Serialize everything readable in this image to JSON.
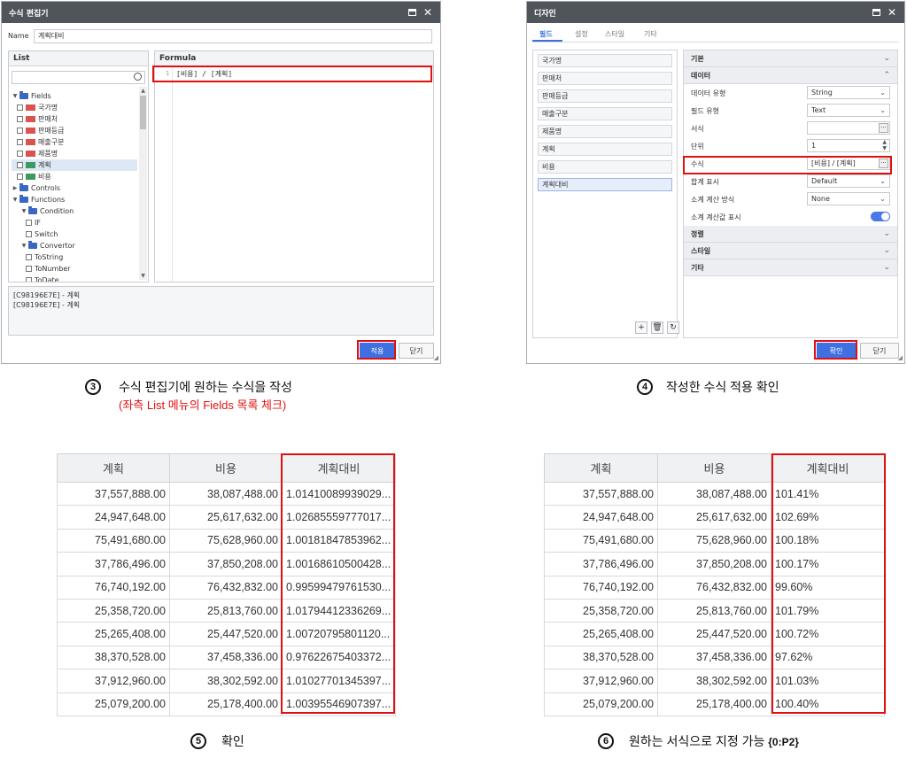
{
  "formula_editor": {
    "title": "수식 편집기",
    "name_label": "Name",
    "name_value": "계획대비",
    "list_header": "List",
    "formula_header": "Formula",
    "formula_line_no": "1",
    "formula_text": "[비용] / [계획]",
    "tree": {
      "fields": "Fields",
      "field_items": [
        "국가명",
        "판매처",
        "판매등급",
        "매출구분",
        "제품명",
        "계획",
        "비용"
      ],
      "controls": "Controls",
      "functions": "Functions",
      "condition": "Condition",
      "condition_items": [
        "IF",
        "Switch"
      ],
      "convertor": "Convertor",
      "convertor_items": [
        "ToString",
        "ToNumber",
        "ToDate"
      ]
    },
    "info_lines": [
      "[C98196E7E] - 계획",
      "[C98196E7E] - 계획"
    ],
    "apply_label": "적용",
    "close_label": "닫기"
  },
  "design_dialog": {
    "title": "디자인",
    "tabs": [
      "필드",
      "설정",
      "스타일",
      "기타"
    ],
    "field_list": [
      "국가명",
      "판매처",
      "판매등급",
      "매출구분",
      "제품명",
      "계획",
      "비용",
      "계획대비"
    ],
    "sections": {
      "basic": "기본",
      "data": "데이터",
      "align": "정렬",
      "style": "스타일",
      "etc": "기타"
    },
    "props": {
      "data_type_label": "데이터 유형",
      "data_type_value": "String",
      "field_type_label": "필드 유형",
      "field_type_value": "Text",
      "format_label": "서식",
      "format_value": "",
      "unit_label": "단위",
      "unit_value": "1",
      "formula_label": "수식",
      "formula_value": "[비용] / [계획]",
      "total_label": "합계 표시",
      "total_value": "Default",
      "subtotal_calc_label": "소계 계산 방식",
      "subtotal_calc_value": "None",
      "subtotal_show_label": "소계 계산값 표시"
    },
    "ok_label": "확인",
    "close_label": "닫기"
  },
  "captions": {
    "step3_num": "3",
    "step3": "수식 편집기에 원하는 수식을 작성",
    "step3_red": "(좌측 List 메뉴의 Fields 목록 체크)",
    "step4_num": "4",
    "step4": "작성한 수식 적용 확인",
    "step5_num": "5",
    "step5": "확인",
    "step6_num": "6",
    "step6": "원하는 서식으로 지정 가능",
    "step6_bold": "{0:P2}"
  },
  "table_raw": {
    "headers": [
      "계획",
      "비용",
      "계획대비"
    ],
    "rows": [
      [
        "37,557,888.00",
        "38,087,488.00",
        "1.01410089939029..."
      ],
      [
        "24,947,648.00",
        "25,617,632.00",
        "1.02685559777017..."
      ],
      [
        "75,491,680.00",
        "75,628,960.00",
        "1.00181847853962..."
      ],
      [
        "37,786,496.00",
        "37,850,208.00",
        "1.00168610500428..."
      ],
      [
        "76,740,192.00",
        "76,432,832.00",
        "0.99599479761530..."
      ],
      [
        "25,358,720.00",
        "25,813,760.00",
        "1.01794412336269..."
      ],
      [
        "25,265,408.00",
        "25,447,520.00",
        "1.00720795801120..."
      ],
      [
        "38,370,528.00",
        "37,458,336.00",
        "0.97622675403372..."
      ],
      [
        "37,912,960.00",
        "38,302,592.00",
        "1.01027701345397..."
      ],
      [
        "25,079,200.00",
        "25,178,400.00",
        "1.00395546907397..."
      ]
    ]
  },
  "table_formatted": {
    "headers": [
      "계획",
      "비용",
      "계획대비"
    ],
    "rows": [
      [
        "37,557,888.00",
        "38,087,488.00",
        "101.41%"
      ],
      [
        "24,947,648.00",
        "25,617,632.00",
        "102.69%"
      ],
      [
        "75,491,680.00",
        "75,628,960.00",
        "100.18%"
      ],
      [
        "37,786,496.00",
        "37,850,208.00",
        "100.17%"
      ],
      [
        "76,740,192.00",
        "76,432,832.00",
        "99.60%"
      ],
      [
        "25,358,720.00",
        "25,813,760.00",
        "101.79%"
      ],
      [
        "25,265,408.00",
        "25,447,520.00",
        "100.72%"
      ],
      [
        "38,370,528.00",
        "37,458,336.00",
        "97.62%"
      ],
      [
        "37,912,960.00",
        "38,302,592.00",
        "101.03%"
      ],
      [
        "25,079,200.00",
        "25,178,400.00",
        "100.40%"
      ]
    ]
  }
}
